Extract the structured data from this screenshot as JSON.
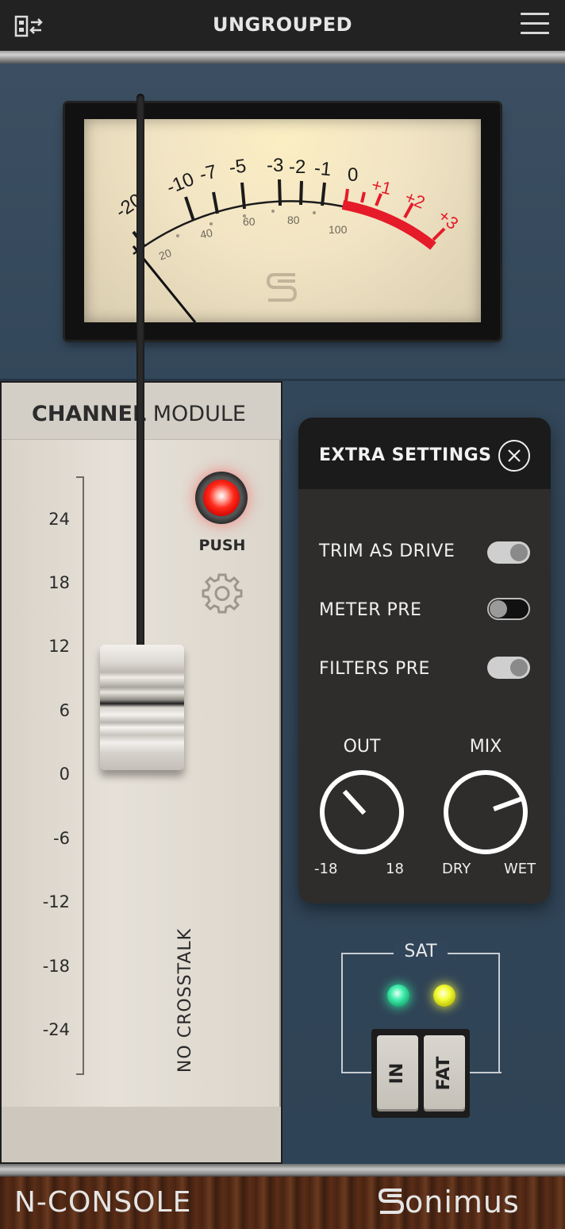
{
  "header": {
    "title": "UNGROUPED",
    "group_icon": "group-switch-icon",
    "menu_icon": "hamburger-menu-icon"
  },
  "vu_meter": {
    "scale_db": [
      "-20",
      "-10",
      "-7",
      "-5",
      "-3",
      "-2",
      "-1",
      "0",
      "+1",
      "+2",
      "+3"
    ],
    "scale_percent": [
      "20",
      "40",
      "60",
      "80",
      "100"
    ],
    "logo_icon": "sonimus-s-logo-icon",
    "accent_red": "#e51b2a"
  },
  "channel": {
    "title_bold": "CHANNEL",
    "title_light": "MODULE",
    "fader_scale": [
      "24",
      "18",
      "12",
      "6",
      "0",
      "-6",
      "-12",
      "-18",
      "-24"
    ],
    "push_label": "PUSH",
    "vertical_label": "NO CROSSTALK"
  },
  "extra_settings": {
    "title": "EXTRA SETTINGS",
    "toggles": [
      {
        "label": "TRIM AS DRIVE",
        "state": "on"
      },
      {
        "label": "METER PRE",
        "state": "off"
      },
      {
        "label": "FILTERS PRE",
        "state": "on"
      }
    ],
    "out": {
      "label": "OUT",
      "min": "-18",
      "max": "18"
    },
    "mix": {
      "label": "MIX",
      "min": "DRY",
      "max": "WET"
    }
  },
  "sat": {
    "label": "SAT",
    "led_colors": [
      "#3ef0b0",
      "#f5ff3a"
    ],
    "buttons": [
      "IN",
      "FAT"
    ]
  },
  "footer": {
    "product": "N-CONSOLE",
    "brand": "onimus",
    "brand_icon": "sonimus-s-logo-icon"
  }
}
